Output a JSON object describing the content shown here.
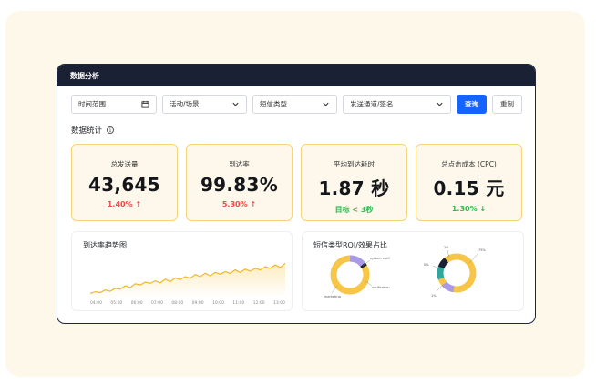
{
  "window": {
    "title": "数据分析"
  },
  "filters": {
    "time_range": "时间范围",
    "activity": "活动/场景",
    "sms_type": "短信类型",
    "channel": "发送通道/签名",
    "query_label": "查询",
    "reset_label": "重制"
  },
  "stats_section": {
    "title": "数据统计",
    "info_glyph": "i"
  },
  "stats": [
    {
      "label": "总发送量",
      "value": "43,645",
      "change": "1.40%",
      "arrow": "↑",
      "color": "#f04646"
    },
    {
      "label": "到达率",
      "value": "99.83%",
      "change": "5.30%",
      "arrow": "↑",
      "color": "#f04646"
    },
    {
      "label": "平均到达耗时",
      "value": "1.87 秒",
      "target": "目标 < 3秒",
      "color": "#2db84d"
    },
    {
      "label": "总点击成本 (CPC)",
      "value": "0.15 元",
      "change": "1.30%",
      "arrow": "↓",
      "color": "#2db84d"
    }
  ],
  "trend_panel": {
    "title": "到达率趋势图",
    "x_ticks": [
      "04:00",
      "05:00",
      "06:00",
      "07:00",
      "08:00",
      "09:00",
      "10:00",
      "11:00",
      "12:00",
      "13:00"
    ]
  },
  "roi_panel": {
    "title": "短信类型ROI/效果占比",
    "donut1_labels": [
      "system notif",
      "verification",
      "marketing"
    ],
    "donut2_labels": [
      "2%",
      "5%",
      "1%",
      "75%"
    ]
  },
  "colors": {
    "accent": "#1664ff",
    "yellow": "#f7c648",
    "purple": "#a99ae8",
    "teal": "#2fa7a0",
    "dark": "#1b2134"
  },
  "chart_data": {
    "type": "line",
    "title": "到达率趋势图",
    "x": [
      "04:00",
      "05:00",
      "06:00",
      "07:00",
      "08:00",
      "09:00",
      "10:00",
      "11:00",
      "12:00",
      "13:00"
    ],
    "series": [
      {
        "values": [
          10,
          14,
          12,
          18,
          15,
          22,
          20,
          28,
          24,
          33,
          30,
          37,
          34,
          40,
          35,
          44,
          38,
          47,
          43,
          50,
          46,
          55,
          50,
          58,
          52,
          60,
          56,
          62,
          58,
          66,
          60,
          68,
          63,
          70,
          66,
          74,
          70,
          78,
          72,
          82
        ]
      }
    ],
    "ylim": [
      0,
      100
    ],
    "grid": false
  }
}
